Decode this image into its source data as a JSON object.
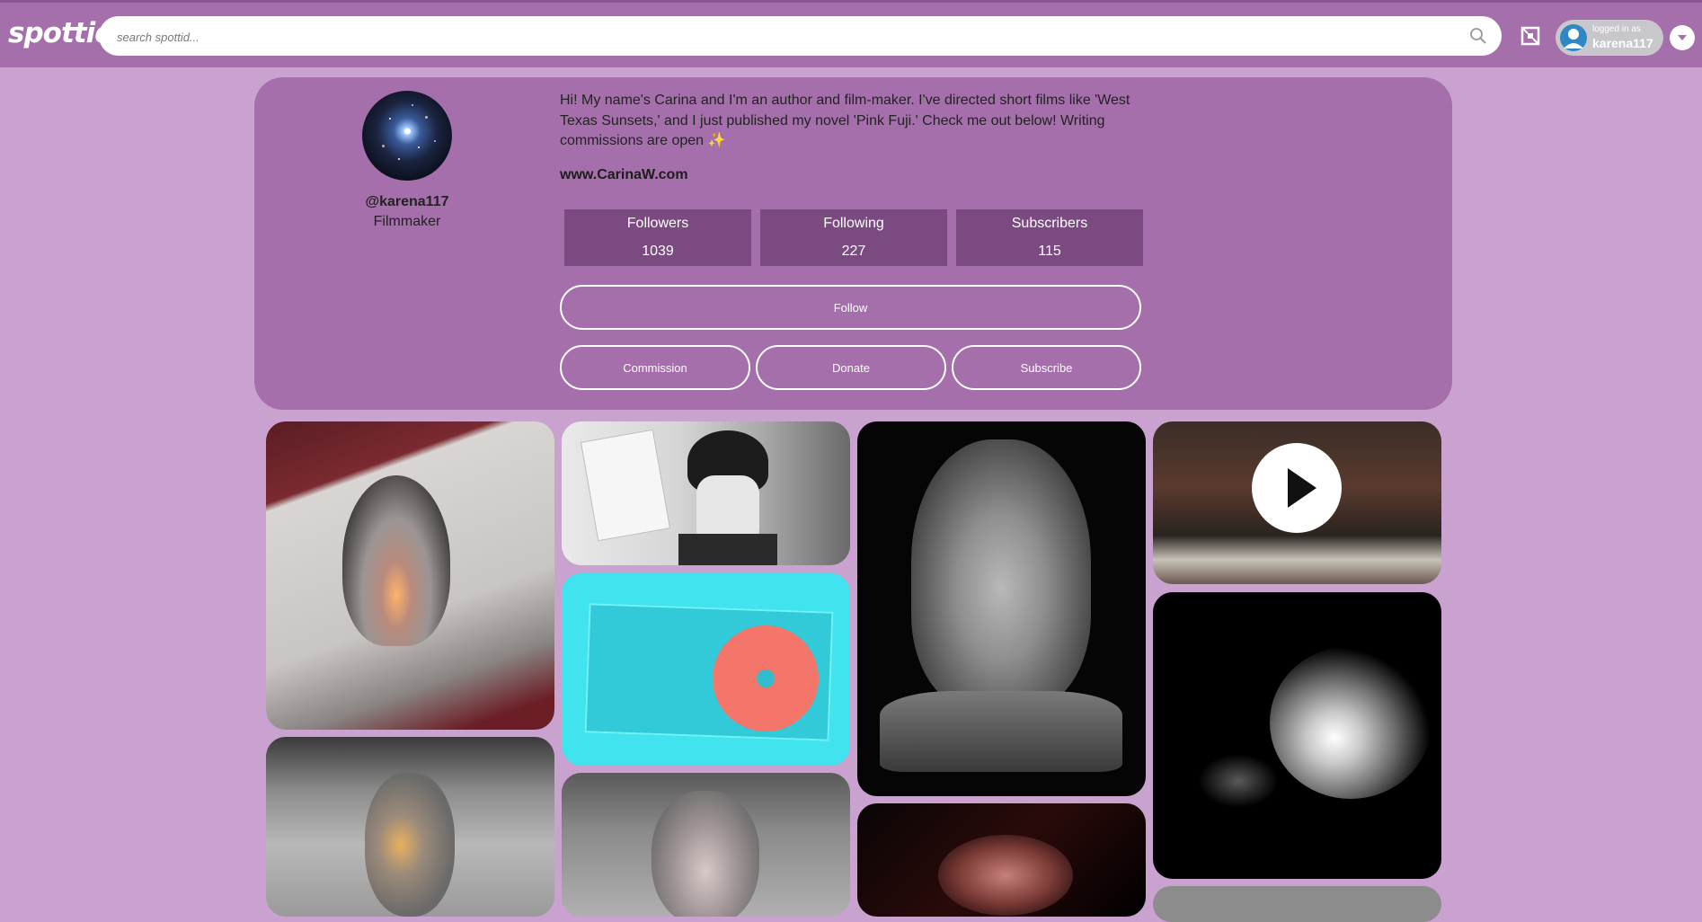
{
  "app": {
    "logo": "spottid",
    "search_placeholder": "search spottid...",
    "logged_in_label": "logged in as",
    "logged_in_user": "karena117"
  },
  "profile": {
    "handle": "@karena117",
    "role": "Filmmaker",
    "bio": "Hi! My name's Carina and I'm an author and film-maker. I've directed short films like 'West Texas Sunsets,' and I just published my novel 'Pink Fuji.' Check me out below! Writing commissions are open ✨",
    "website": "www.CarinaW.com",
    "stats": [
      {
        "label": "Followers",
        "value": "1039"
      },
      {
        "label": "Following",
        "value": "227"
      },
      {
        "label": "Subscribers",
        "value": "115"
      }
    ],
    "buttons": {
      "follow": "Follow",
      "commission": "Commission",
      "donate": "Donate",
      "subscribe": "Subscribe"
    }
  },
  "gallery": {
    "items": [
      {
        "name": "drawing-portrait-hood",
        "kind": "image"
      },
      {
        "name": "illustration-boy-paper",
        "kind": "image"
      },
      {
        "name": "cd-case-photo",
        "kind": "image"
      },
      {
        "name": "sculpture-child-bust",
        "kind": "image"
      },
      {
        "name": "animation-clip",
        "kind": "video"
      },
      {
        "name": "fireworks-bw-photo",
        "kind": "image"
      },
      {
        "name": "drawing-portrait-glow",
        "kind": "image"
      },
      {
        "name": "drawing-girl-horns",
        "kind": "image"
      },
      {
        "name": "dark-portrait-photo",
        "kind": "image"
      }
    ]
  },
  "colors": {
    "page_bg": "#c9a2d0",
    "bar_bg": "#a56fac",
    "stat_bg": "#7b4a80"
  }
}
